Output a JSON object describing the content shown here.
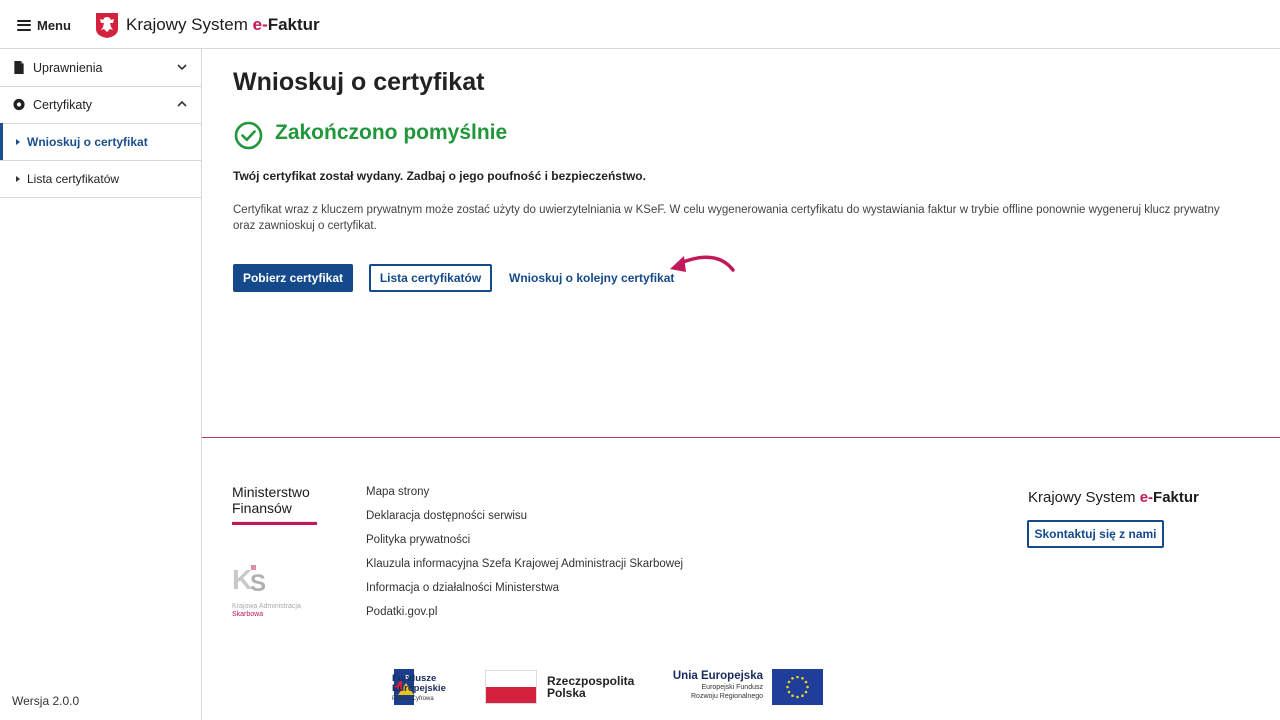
{
  "header": {
    "menu_label": "Menu",
    "brand_prefix": "Krajowy System ",
    "brand_e": "e-",
    "brand_suffix": "Faktur"
  },
  "sidebar": {
    "items": [
      {
        "label": "Uprawnienia",
        "icon": "document-icon",
        "expanded": false
      },
      {
        "label": "Certyfikaty",
        "icon": "certificate-icon",
        "expanded": true
      }
    ],
    "subitems": [
      {
        "label": "Wnioskuj o certyfikat",
        "active": true
      },
      {
        "label": "Lista certyfikatów",
        "active": false
      }
    ],
    "version": "Wersja 2.0.0"
  },
  "main": {
    "title": "Wnioskuj o certyfikat",
    "success_title": "Zakończono pomyślnie",
    "lead": "Twój certyfikat został wydany. Zadbaj o jego poufność i bezpieczeństwo.",
    "description": "Certyfikat wraz z kluczem prywatnym może zostać użyty do uwierzytelniania w KSeF. W celu wygenerowania certyfikatu do wystawiania faktur w trybie offline ponownie wygeneruj klucz prywatny oraz zawnioskuj o certyfikat.",
    "buttons": {
      "download": "Pobierz certyfikat",
      "list": "Lista certyfikatów",
      "request_next": "Wnioskuj o kolejny certyfikat"
    }
  },
  "footer": {
    "ministry": [
      "Ministerstwo",
      "Finansów"
    ],
    "kas_text": [
      "Krajowa Administracja",
      "Skarbowa"
    ],
    "links": [
      "Mapa strony",
      "Deklaracja dostępności serwisu",
      "Polityka prywatności",
      "Klauzula informacyjna Szefa Krajowej Administracji Skarbowej",
      "Informacja o działalności Ministerstwa",
      "Podatki.gov.pl"
    ],
    "brand_prefix": "Krajowy System ",
    "brand_e": "e-",
    "brand_suffix": "Faktur",
    "contact": "Skontaktuj się z nami",
    "fe": {
      "line1": "Fundusze",
      "line2": "Europejskie",
      "sub": "Polska Cyfrowa"
    },
    "rp": {
      "line1": "Rzeczpospolita",
      "line2": "Polska"
    },
    "ue": {
      "title": "Unia Europejska",
      "sub1": "Europejski Fundusz",
      "sub2": "Rozwoju Regionalnego"
    }
  },
  "colors": {
    "accent": "#144a8c",
    "success": "#22963b",
    "brand_e": "#c2185b",
    "annotation_arrow": "#c2185b"
  }
}
